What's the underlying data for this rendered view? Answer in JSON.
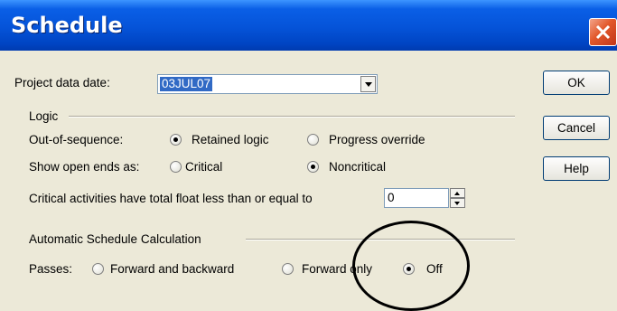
{
  "window": {
    "title": "Schedule"
  },
  "project": {
    "label": "Project data date:",
    "date_value": "03JUL07"
  },
  "logic": {
    "group_label": "Logic",
    "out_of_sequence_label": "Out-of-sequence:",
    "retained_logic": "Retained logic",
    "progress_override": "Progress override",
    "show_open_ends_label": "Show open ends as:",
    "critical": "Critical",
    "noncritical": "Noncritical",
    "out_of_sequence_selected": "Retained logic",
    "open_ends_selected": "Noncritical"
  },
  "critical_float": {
    "label": "Critical activities have total float less than or equal to",
    "value": "0"
  },
  "auto_calc": {
    "group_label": "Automatic Schedule Calculation",
    "passes_label": "Passes:",
    "forward_backward": "Forward and backward",
    "forward_only": "Forward only",
    "off": "Off",
    "selected": "Off"
  },
  "buttons": {
    "ok": "OK",
    "cancel": "Cancel",
    "help": "Help"
  },
  "colors": {
    "titlebar": "#0553d8",
    "selection": "#316ac5",
    "close": "#e2582b"
  }
}
